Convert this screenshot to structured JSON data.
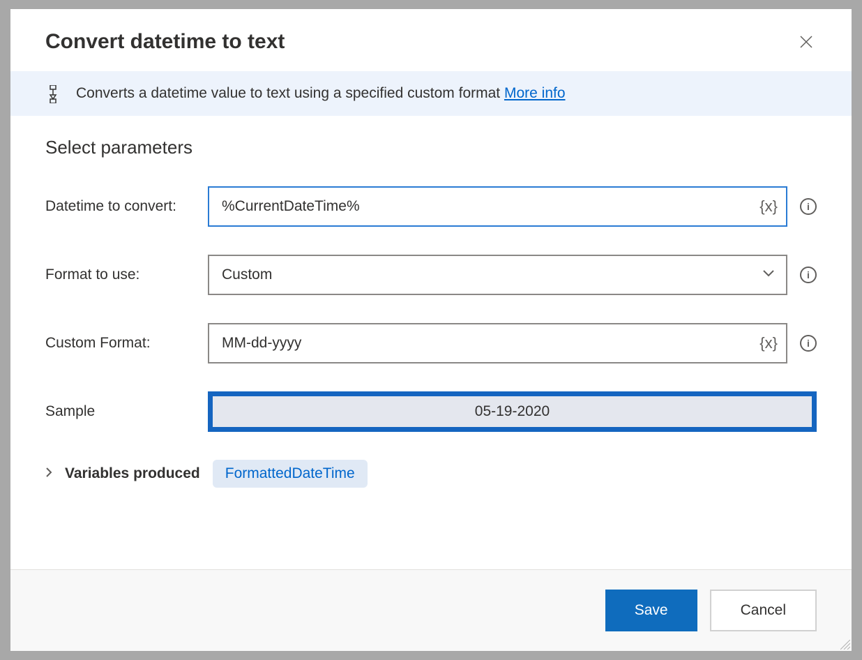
{
  "dialog": {
    "title": "Convert datetime to text",
    "banner": {
      "description": "Converts a datetime value to text using a specified custom format ",
      "linkText": "More info"
    },
    "sectionTitle": "Select parameters",
    "fields": {
      "datetimeToConvert": {
        "label": "Datetime to convert:",
        "value": "%CurrentDateTime%"
      },
      "formatToUse": {
        "label": "Format to use:",
        "value": "Custom"
      },
      "customFormat": {
        "label": "Custom Format:",
        "value": "MM-dd-yyyy"
      },
      "sample": {
        "label": "Sample",
        "value": "05-19-2020"
      }
    },
    "variables": {
      "label": "Variables produced",
      "badge": "FormattedDateTime"
    },
    "buttons": {
      "save": "Save",
      "cancel": "Cancel"
    }
  }
}
